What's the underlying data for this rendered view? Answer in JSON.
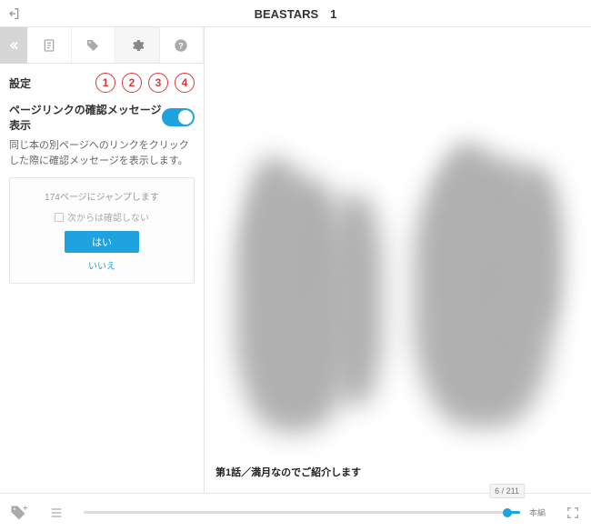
{
  "header": {
    "title": "BEASTARS　1"
  },
  "sidebar": {
    "title": "設定",
    "badges": [
      "1",
      "2",
      "3",
      "4"
    ],
    "setting": {
      "label": "ページリンクの確認メッセージ表示",
      "desc": "同じ本の別ページへのリンクをクリックした際に確認メッセージを表示します。",
      "preview": {
        "msg": "174ページにジャンプします",
        "checkbox": "次からは確認しない",
        "yes": "はい",
        "no": "いいえ"
      }
    }
  },
  "content": {
    "caption": "第1話／満月なのでご紹介します"
  },
  "footer": {
    "page_indicator": "6 / 211",
    "slider_pct": 97,
    "label": "本編"
  }
}
